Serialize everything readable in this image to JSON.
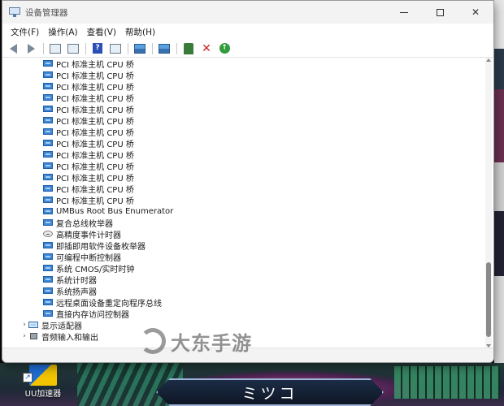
{
  "window": {
    "title": "设备管理器",
    "controls": {
      "minimize": "",
      "maximize": "",
      "close": "✕"
    }
  },
  "menu": {
    "items": [
      "文件(F)",
      "操作(A)",
      "查看(V)",
      "帮助(H)"
    ]
  },
  "toolbar": {
    "buttons": [
      "back-arrow-icon",
      "forward-arrow-icon",
      "properties-icon",
      "show-hide-icon",
      "help-icon",
      "view-icon",
      "scan-icon",
      "monitor-icon",
      "update-driver-icon",
      "uninstall-icon",
      "enable-icon"
    ],
    "help_glyph": "?",
    "remove_glyph": "✕",
    "enable_glyph": "↑"
  },
  "tree": {
    "rows": [
      {
        "label": "PCI 标准主机 CPU 桥",
        "indent": 2,
        "icon": "board"
      },
      {
        "label": "PCI 标准主机 CPU 桥",
        "indent": 2,
        "icon": "board"
      },
      {
        "label": "PCI 标准主机 CPU 桥",
        "indent": 2,
        "icon": "board"
      },
      {
        "label": "PCI 标准主机 CPU 桥",
        "indent": 2,
        "icon": "board"
      },
      {
        "label": "PCI 标准主机 CPU 桥",
        "indent": 2,
        "icon": "board"
      },
      {
        "label": "PCI 标准主机 CPU 桥",
        "indent": 2,
        "icon": "board"
      },
      {
        "label": "PCI 标准主机 CPU 桥",
        "indent": 2,
        "icon": "board"
      },
      {
        "label": "PCI 标准主机 CPU 桥",
        "indent": 2,
        "icon": "board"
      },
      {
        "label": "PCI 标准主机 CPU 桥",
        "indent": 2,
        "icon": "board"
      },
      {
        "label": "PCI 标准主机 CPU 桥",
        "indent": 2,
        "icon": "board"
      },
      {
        "label": "PCI 标准主机 CPU 桥",
        "indent": 2,
        "icon": "board"
      },
      {
        "label": "PCI 标准主机 CPU 桥",
        "indent": 2,
        "icon": "board"
      },
      {
        "label": "PCI 标准主机 CPU 桥",
        "indent": 2,
        "icon": "board"
      },
      {
        "label": "UMBus Root Bus Enumerator",
        "indent": 2,
        "icon": "board"
      },
      {
        "label": "复合总线枚举器",
        "indent": 2,
        "icon": "board"
      },
      {
        "label": "高精度事件计时器",
        "indent": 2,
        "icon": "timer"
      },
      {
        "label": "即插即用软件设备枚举器",
        "indent": 2,
        "icon": "board"
      },
      {
        "label": "可编程中断控制器",
        "indent": 2,
        "icon": "board"
      },
      {
        "label": "系统 CMOS/实时时钟",
        "indent": 2,
        "icon": "board"
      },
      {
        "label": "系统计时器",
        "indent": 2,
        "icon": "board"
      },
      {
        "label": "系统扬声器",
        "indent": 2,
        "icon": "board"
      },
      {
        "label": "远程桌面设备重定向程序总线",
        "indent": 2,
        "icon": "board"
      },
      {
        "label": "直接内存访问控制器",
        "indent": 2,
        "icon": "board"
      },
      {
        "label": "显示适配器",
        "indent": 1,
        "icon": "display",
        "collapsed": true
      },
      {
        "label": "音频输入和输出",
        "indent": 1,
        "icon": "audio",
        "collapsed": true
      }
    ],
    "expander_glyph": "›"
  },
  "watermark": {
    "text": "大东手游"
  },
  "desktop": {
    "icon_label": "UU加速器",
    "shortcut_glyph": "↗",
    "name_plate": "ミツコ"
  }
}
